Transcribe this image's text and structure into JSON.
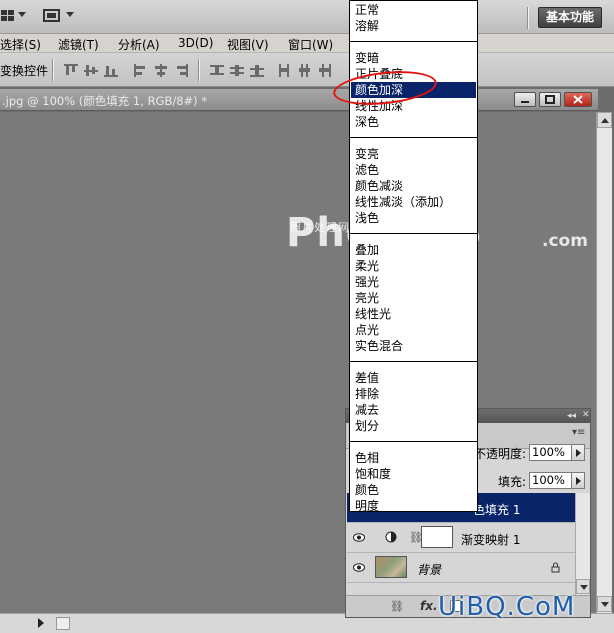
{
  "app": {
    "workspace_button": "基本功能"
  },
  "menubar": {
    "items": [
      "选择(S)",
      "滤镜(T)",
      "分析(A)",
      "3D(D)",
      "视图(V)",
      "窗口(W)"
    ]
  },
  "options_bar": {
    "transform_controls_label": "变换控件"
  },
  "document": {
    "tab_title": ".jpg @ 100% (颜色填充 1, RGB/8#) *"
  },
  "watermark": {
    "small_text": "照片处理网",
    "big_text": "PhotoPS",
    "suffix": ".com",
    "site_mark": "UiBQ.CoM"
  },
  "blend_menu": {
    "groups": [
      [
        "正常",
        "溶解"
      ],
      [
        "变暗",
        "正片叠底",
        "颜色加深",
        "线性加深",
        "深色"
      ],
      [
        "变亮",
        "滤色",
        "颜色减淡",
        "线性减淡（添加）",
        "浅色"
      ],
      [
        "叠加",
        "柔光",
        "强光",
        "亮光",
        "线性光",
        "点光",
        "实色混合"
      ],
      [
        "差值",
        "排除",
        "减去",
        "划分"
      ],
      [
        "色相",
        "饱和度",
        "颜色",
        "明度"
      ]
    ],
    "selected": "颜色加深",
    "highlight_color": "#0a246a"
  },
  "layers_panel": {
    "opacity_label": "不透明度:",
    "opacity_value": "100%",
    "fill_label": "填充:",
    "fill_value": "100%",
    "layers": [
      {
        "name": "色填充 1",
        "selected": true
      },
      {
        "name": "渐变映射 1",
        "selected": false
      },
      {
        "name": "背景",
        "selected": false,
        "locked": true
      }
    ],
    "footer_fx": "fx."
  },
  "colors": {
    "canvas": "#7a7a7a",
    "annotation": "#e3140e"
  }
}
